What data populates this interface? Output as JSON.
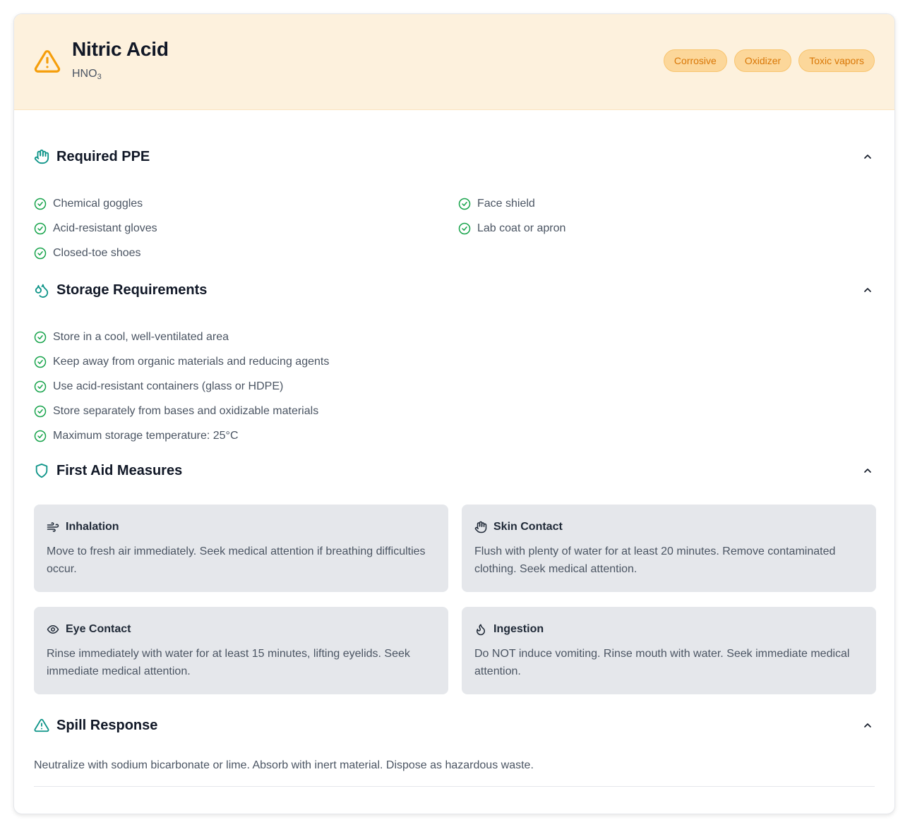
{
  "header": {
    "title": "Nitric Acid",
    "formula_main": "HNO",
    "formula_sub": "3",
    "icon": "warning-triangle-icon",
    "badges": [
      "Corrosive",
      "Oxidizer",
      "Toxic vapors"
    ]
  },
  "colors": {
    "header_bg": "#fdf1dd",
    "badge_bg": "#fcd79a",
    "badge_text": "#d97706",
    "accent_teal": "#0d9488",
    "check_green": "#16a34a",
    "aid_card_bg": "#e5e7eb"
  },
  "ppe": {
    "title": "Required PPE",
    "icon": "hand-icon",
    "left": [
      "Chemical goggles",
      "Acid-resistant gloves",
      "Closed-toe shoes"
    ],
    "right": [
      "Face shield",
      "Lab coat or apron"
    ]
  },
  "storage": {
    "title": "Storage Requirements",
    "icon": "droplets-icon",
    "items": [
      "Store in a cool, well-ventilated area",
      "Keep away from organic materials and reducing agents",
      "Use acid-resistant containers (glass or HDPE)",
      "Store separately from bases and oxidizable materials",
      "Maximum storage temperature: 25°C"
    ]
  },
  "first_aid": {
    "title": "First Aid Measures",
    "icon": "shield-icon",
    "cards": [
      {
        "title": "Inhalation",
        "icon": "wind-icon",
        "text": "Move to fresh air immediately. Seek medical attention if breathing difficulties occur."
      },
      {
        "title": "Skin Contact",
        "icon": "hand-icon",
        "text": "Flush with plenty of water for at least 20 minutes. Remove contaminated clothing. Seek medical attention."
      },
      {
        "title": "Eye Contact",
        "icon": "eye-icon",
        "text": "Rinse immediately with water for at least 15 minutes, lifting eyelids. Seek immediate medical attention."
      },
      {
        "title": "Ingestion",
        "icon": "flame-icon",
        "text": "Do NOT induce vomiting. Rinse mouth with water. Seek immediate medical attention."
      }
    ]
  },
  "spill": {
    "title": "Spill Response",
    "icon": "warning-triangle-icon",
    "text": "Neutralize with sodium bicarbonate or lime. Absorb with inert material. Dispose as hazardous waste."
  }
}
